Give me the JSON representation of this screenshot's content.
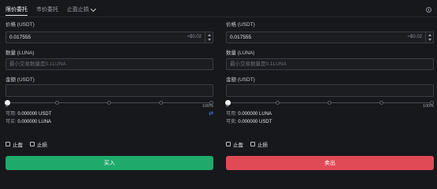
{
  "tabs": [
    {
      "label": "限价委托",
      "active": true
    },
    {
      "label": "市价委托",
      "active": false
    },
    {
      "label": "止盈止损",
      "active": false,
      "dropdown": true
    }
  ],
  "buy": {
    "price_label": "价格 (USDT)",
    "price_value": "0.017555",
    "price_approx": "≈$0.02",
    "qty_label": "数量 (LUNA)",
    "qty_placeholder": "最小交易数量是0.1LUNA",
    "amount_label": "金额 (USDT)",
    "slider_min": "0",
    "slider_max": "100%",
    "slider_value": 0,
    "avail_label": "可用:",
    "avail_value": "0.000000 USDT",
    "can_label": "可买:",
    "can_value": "0.000000 LUNA",
    "take_profit": "止盈",
    "stop_loss": "止损",
    "button": "买入"
  },
  "sell": {
    "price_label": "价格 (USDT)",
    "price_value": "0.017555",
    "price_approx": "≈$0.02",
    "qty_label": "数量 (LUNA)",
    "qty_placeholder": "最小交易数量是0.1LUNA",
    "amount_label": "金额 (USDT)",
    "slider_min": "0",
    "slider_max": "100%",
    "slider_value": 0,
    "avail_label": "可用:",
    "avail_value": "0.000000 LUNA",
    "can_label": "可卖:",
    "can_value": "0.000000 USDT",
    "take_profit": "止盈",
    "stop_loss": "止损",
    "button": "卖出"
  },
  "icons": {
    "info": "info-icon",
    "swap": "swap-icon",
    "dropdown": "chevron-down-icon"
  },
  "colors": {
    "background": "#17181c",
    "buy": "#1fa96b",
    "sell": "#e04a57",
    "accent": "#3b82f6"
  }
}
